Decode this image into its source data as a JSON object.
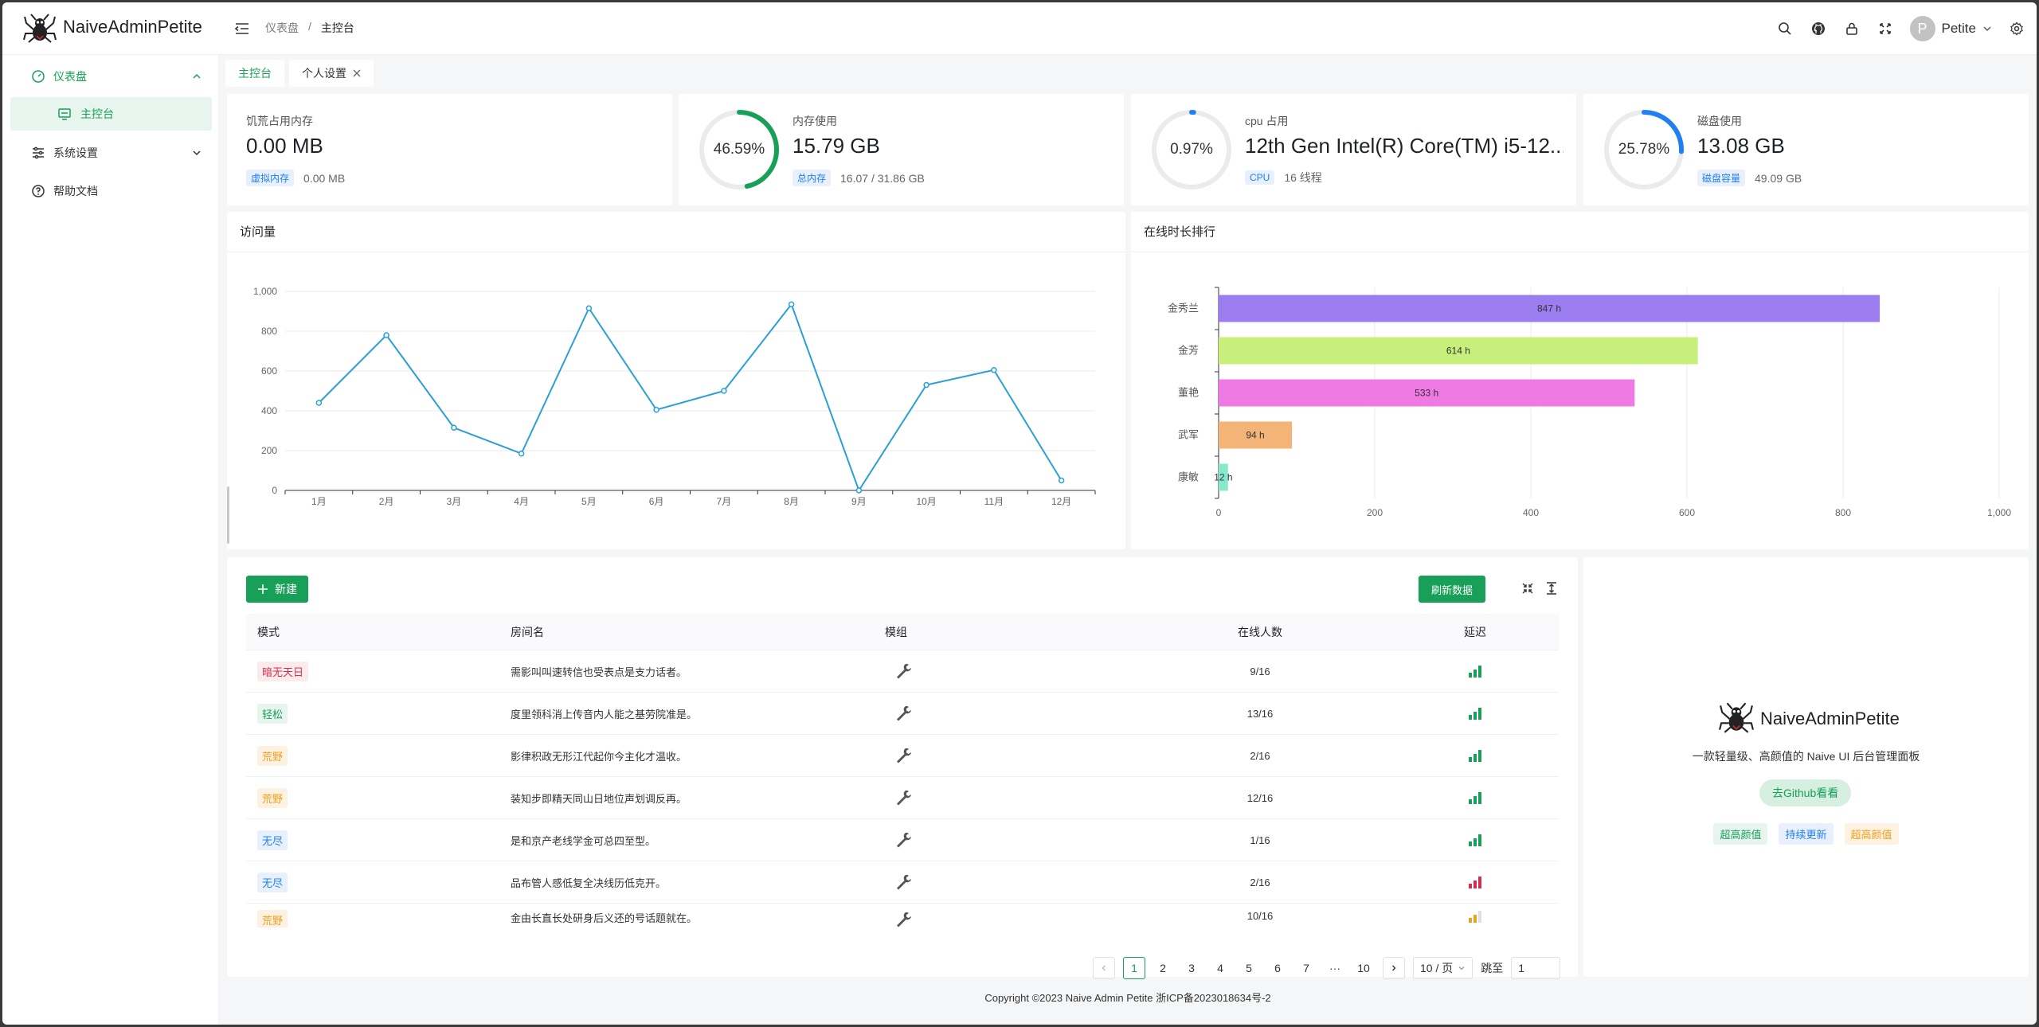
{
  "header": {
    "brand": "NaiveAdminPetite",
    "breadcrumb": [
      "仪表盘",
      "/",
      "主控台"
    ],
    "user": "Petite",
    "avatar_letter": "P"
  },
  "sidebar": {
    "items": [
      {
        "label": "仪表盘",
        "icon": "dashboard-icon",
        "state": "open"
      },
      {
        "label": "主控台",
        "icon": "monitor-icon",
        "state": "selected"
      },
      {
        "label": "系统设置",
        "icon": "settings-sliders-icon",
        "state": "collapsed"
      },
      {
        "label": "帮助文档",
        "icon": "help-circle-icon",
        "state": "none"
      }
    ]
  },
  "tabs": [
    {
      "label": "主控台"
    },
    {
      "label": "个人设置"
    }
  ],
  "stats": [
    {
      "label": "饥荒占用内存",
      "value": "0.00 MB",
      "tag": "虚拟内存",
      "sub": "0.00 MB"
    },
    {
      "label": "内存使用",
      "value": "15.79 GB",
      "tag": "总内存",
      "sub": "16.07 / 31.86 GB",
      "percent": "46.59%",
      "ratio": 0.4659,
      "color": "#18a058"
    },
    {
      "label": "cpu 占用",
      "value": "12th Gen Intel(R) Core(TM) i5-12...",
      "tag": "CPU",
      "sub": "16 线程",
      "percent": "0.97%",
      "ratio": 0.0097,
      "color": "#2080f0"
    },
    {
      "label": "磁盘使用",
      "value": "13.08 GB",
      "tag": "磁盘容量",
      "sub": "49.09 GB",
      "percent": "25.78%",
      "ratio": 0.2578,
      "color": "#2080f0"
    }
  ],
  "visits": {
    "title": "访问量",
    "chart_data": {
      "type": "line",
      "categories": [
        "1月",
        "2月",
        "3月",
        "4月",
        "5月",
        "6月",
        "7月",
        "8月",
        "9月",
        "10月",
        "11月",
        "12月",
        ""
      ],
      "values": [
        440,
        780,
        315,
        185,
        915,
        405,
        500,
        935,
        0,
        530,
        605,
        50
      ],
      "ylim": [
        0,
        1000
      ],
      "yticks": [
        "0",
        "200",
        "400",
        "600",
        "800",
        "1,000"
      ],
      "color": "#2c9fd6",
      "grid": true
    }
  },
  "online": {
    "title": "在线时长排行",
    "chart_data": {
      "type": "bar",
      "orientation": "horizontal",
      "categories": [
        "金秀兰",
        "金芳",
        "董艳",
        "武军",
        "康敏"
      ],
      "values": [
        847,
        614,
        533,
        94,
        12
      ],
      "labels": [
        "847 h",
        "614 h",
        "533 h",
        "94 h",
        "12 h"
      ],
      "colors": [
        "#9b7df0",
        "#c8ef7c",
        "#f07ae4",
        "#f4b377",
        "#88e8cd"
      ],
      "xlim": [
        0,
        1000
      ],
      "xticks": [
        "0",
        "200",
        "400",
        "600",
        "800",
        "1,000"
      ],
      "grid": true
    }
  },
  "table": {
    "new_label": "新建",
    "refresh_label": "刷新数据",
    "columns": [
      "模式",
      "房间名",
      "模组",
      "在线人数",
      "延迟"
    ],
    "rows": [
      {
        "mode": "暗无天日",
        "mode_color": "red",
        "name": "需影叫叫速转信也受表点是支力话者。",
        "online": "9/16",
        "latency": "good"
      },
      {
        "mode": "轻松",
        "mode_color": "green",
        "name": "度里领科消上传音内人能之基劳院准是。",
        "online": "13/16",
        "latency": "good"
      },
      {
        "mode": "荒野",
        "mode_color": "orange",
        "name": "影律积政无形江代起你今主化才温收。",
        "online": "2/16",
        "latency": "good"
      },
      {
        "mode": "荒野",
        "mode_color": "orange",
        "name": "装知步即精天同山日地位声划调反再。",
        "online": "12/16",
        "latency": "good"
      },
      {
        "mode": "无尽",
        "mode_color": "blue",
        "name": "是和京产老线学金可总四至型。",
        "online": "1/16",
        "latency": "good"
      },
      {
        "mode": "无尽",
        "mode_color": "blue",
        "name": "品布管人感低复全决线历低克开。",
        "online": "2/16",
        "latency": "bad"
      },
      {
        "mode": "荒野",
        "mode_color": "orange",
        "name": "金由长直长处研身后义还的号话题就在。",
        "online": "10/16",
        "latency": "warn"
      }
    ],
    "pagination": {
      "pages": [
        "1",
        "2",
        "3",
        "4",
        "5",
        "6",
        "7",
        "···",
        "10"
      ],
      "current": "1",
      "page_size": "10 / 页",
      "jump_label": "跳至",
      "jump_value": "1"
    }
  },
  "promo": {
    "title": "NaiveAdminPetite",
    "desc": "一款轻量级、高颜值的 Naive UI 后台管理面板",
    "button": "去Github看看",
    "tags": [
      {
        "label": "超高颜值",
        "color": "green"
      },
      {
        "label": "持续更新",
        "color": "blue"
      },
      {
        "label": "超高颜值",
        "color": "orange"
      }
    ]
  },
  "footer": "Copyright ©2023 Naive Admin Petite    浙ICP备2023018634号-2"
}
